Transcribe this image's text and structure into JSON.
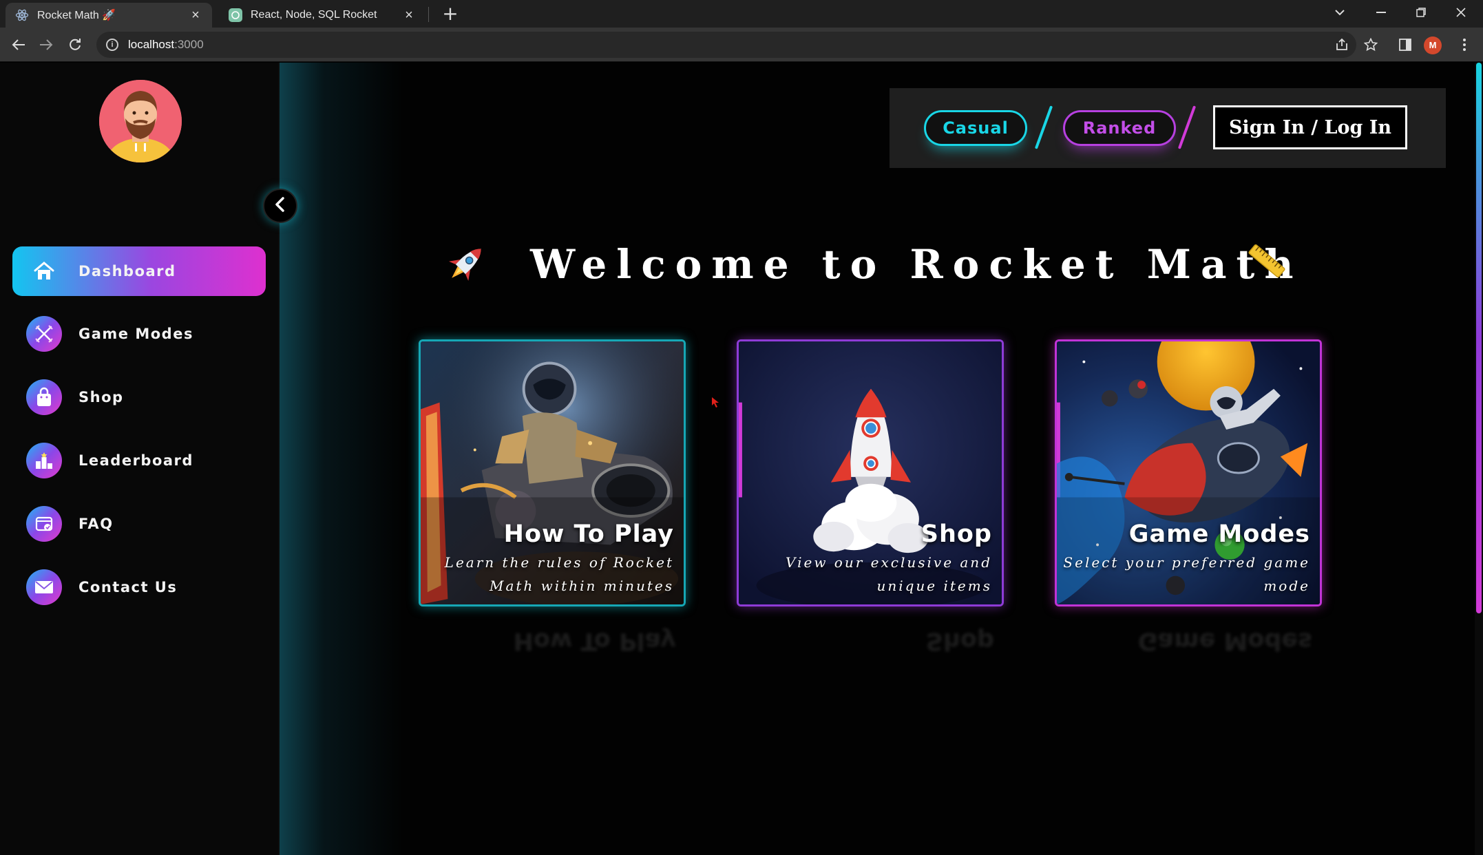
{
  "browser": {
    "tabs": [
      {
        "title": "Rocket Math 🚀",
        "active": true
      },
      {
        "title": "React, Node, SQL Rocket",
        "active": false
      }
    ],
    "url_host": "localhost",
    "url_port": ":3000",
    "profile_initial": "M"
  },
  "sidebar": {
    "items": [
      {
        "label": "Dashboard",
        "icon": "home-icon",
        "active": true
      },
      {
        "label": "Game Modes",
        "icon": "game-modes-icon",
        "active": false
      },
      {
        "label": "Shop",
        "icon": "shopping-bag-icon",
        "active": false
      },
      {
        "label": "Leaderboard",
        "icon": "leaderboard-icon",
        "active": false
      },
      {
        "label": "FAQ",
        "icon": "faq-icon",
        "active": false
      },
      {
        "label": "Contact Us",
        "icon": "mail-icon",
        "active": false
      }
    ]
  },
  "header": {
    "casual_label": "Casual",
    "ranked_label": "Ranked",
    "signin_label": "Sign In / Log In"
  },
  "main": {
    "welcome_title": "Welcome to Rocket Math",
    "cards": [
      {
        "title": "How To Play",
        "description": "Learn the rules of Rocket Math within minutes"
      },
      {
        "title": "Shop",
        "description": "View our exclusive and unique items"
      },
      {
        "title": "Game Modes",
        "description": "Select your preferred game mode"
      }
    ]
  },
  "colors": {
    "cyan_accent": "#19d6e6",
    "purple_accent": "#b640e0",
    "magenta_accent": "#de30cf"
  }
}
